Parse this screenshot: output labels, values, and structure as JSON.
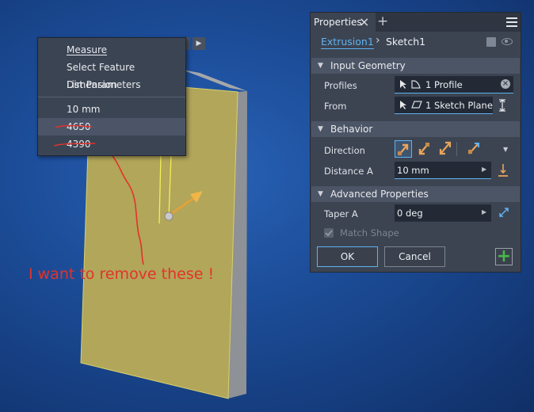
{
  "context_menu": {
    "items": [
      {
        "label": "Measure"
      },
      {
        "label": "Select Feature Dimension"
      },
      {
        "label": "List Parameters"
      }
    ],
    "values": [
      {
        "label": "10 mm"
      },
      {
        "label": "4650"
      },
      {
        "label": "4390"
      }
    ]
  },
  "annotation": {
    "text": "I want to remove these !"
  },
  "panel": {
    "tab_title": "Properties",
    "close_glyph": "×",
    "add_glyph": "+",
    "breadcrumb": {
      "feature": "Extrusion1",
      "separator": "›",
      "sketch": "Sketch1"
    },
    "sections": {
      "input_geometry": "Input Geometry",
      "behavior": "Behavior",
      "advanced": "Advanced Properties"
    },
    "fields": {
      "profiles_label": "Profiles",
      "profiles_value": "1 Profile",
      "from_label": "From",
      "from_value": "1 Sketch Plane",
      "direction_label": "Direction",
      "distance_label": "Distance A",
      "distance_value": "10 mm",
      "taper_label": "Taper A",
      "taper_value": "0 deg",
      "match_shape_label": "Match Shape",
      "match_shape_checked": true
    },
    "buttons": {
      "ok": "OK",
      "cancel": "Cancel",
      "add": "+"
    }
  },
  "colors": {
    "accent": "#5fb2f0",
    "annotation": "#e4322a",
    "part_face": "#b1a65a",
    "add_button": "#49b84a"
  }
}
